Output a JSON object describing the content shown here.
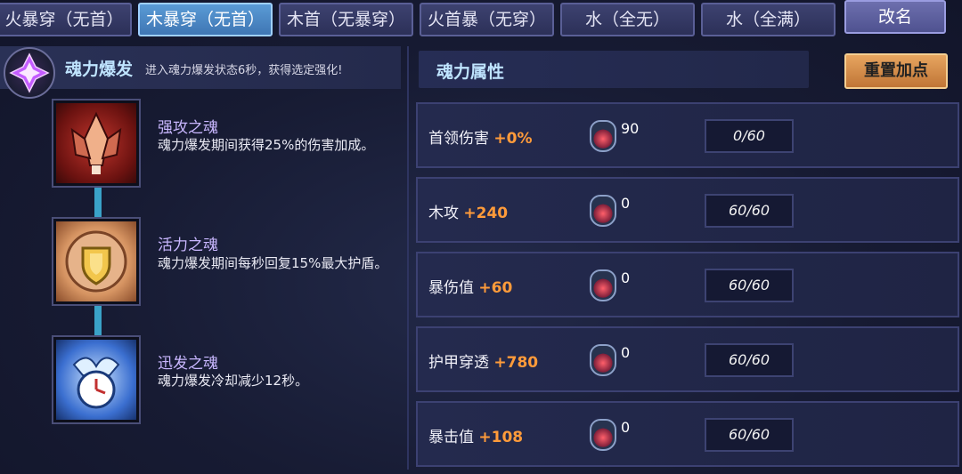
{
  "tabs": [
    {
      "label": "火暴穿（无首）"
    },
    {
      "label": "木暴穿（无首）"
    },
    {
      "label": "木首（无暴穿）"
    },
    {
      "label": "火首暴（无穿）"
    },
    {
      "label": "水（全无）"
    },
    {
      "label": "水（全满）"
    }
  ],
  "active_tab": "木暴穿（无首）",
  "rename_label": "改名",
  "burst": {
    "title": "魂力爆发",
    "description": "进入魂力爆发状态6秒，获得选定强化!"
  },
  "souls": [
    {
      "name": "强攻之魂",
      "text": "魂力爆发期间获得25%的伤害加成。"
    },
    {
      "name": "活力之魂",
      "text": "魂力爆发期间每秒回复15%最大护盾。"
    },
    {
      "name": "迅发之魂",
      "text": "魂力爆发冷却减少12秒。"
    }
  ],
  "attributes": {
    "title": "魂力属性",
    "reset_label": "重置加点",
    "rows": [
      {
        "label": "首领伤害",
        "bonus": "+0%",
        "count": "90",
        "progress": "0/60"
      },
      {
        "label": "木攻",
        "bonus": "+240",
        "count": "0",
        "progress": "60/60"
      },
      {
        "label": "暴伤值",
        "bonus": "+60",
        "count": "0",
        "progress": "60/60"
      },
      {
        "label": "护甲穿透",
        "bonus": "+780",
        "count": "0",
        "progress": "60/60"
      },
      {
        "label": "暴击值",
        "bonus": "+108",
        "count": "0",
        "progress": "60/60"
      }
    ]
  },
  "colors": {
    "active_tab": "#4a8ccb",
    "bonus": "#ff9b3a",
    "reset_button": "#d98c48",
    "connector": "#3aa2c8"
  },
  "icons": [
    "soul-burst-emblem-icon",
    "assault-soul-icon",
    "vitality-soul-icon",
    "swift-soul-icon",
    "soul-gem-icon"
  ]
}
